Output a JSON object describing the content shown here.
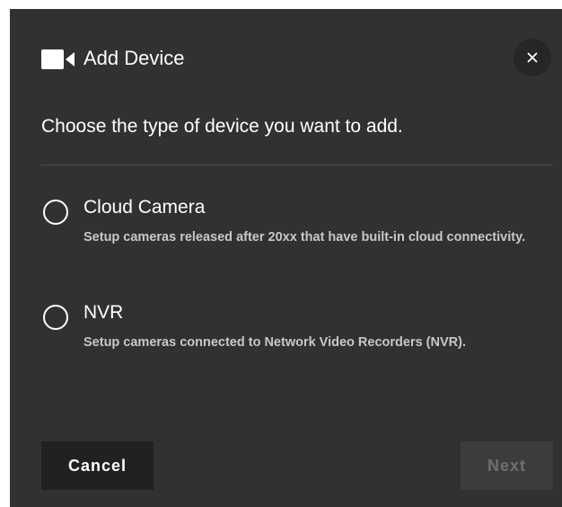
{
  "dialog": {
    "title": "Add Device",
    "title_icon": "video-camera-icon",
    "close_icon": "close-icon",
    "subtitle": "Choose the type of device you want to add.",
    "options": [
      {
        "label": "Cloud Camera",
        "description": "Setup cameras released after 20xx that have built-in cloud connectivity.",
        "selected": false
      },
      {
        "label": "NVR",
        "description": "Setup cameras connected to Network Video Recorders (NVR).",
        "selected": false
      }
    ],
    "cancel_label": "Cancel",
    "next_label": "Next",
    "next_enabled": false
  },
  "colors": {
    "dialog_bg": "#313131",
    "close_bg": "#262626",
    "cancel_bg": "#212121",
    "next_bg_disabled": "#3c3c3c",
    "next_text_disabled": "#6f6f6f",
    "text": "#ffffff",
    "muted_text": "#c8c8c8"
  }
}
